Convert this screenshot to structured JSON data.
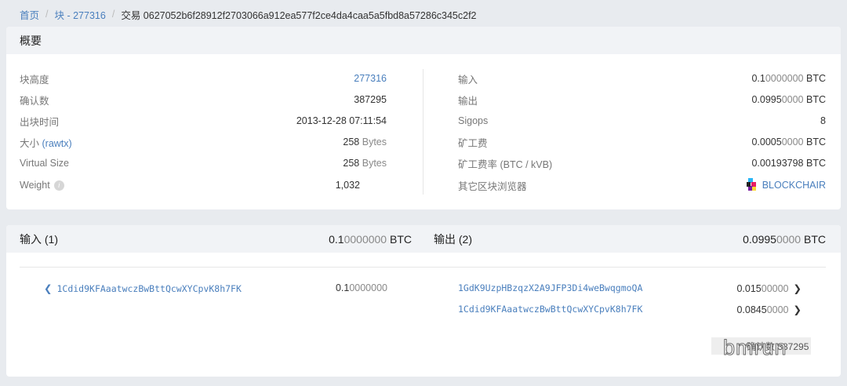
{
  "breadcrumb": {
    "home": "首页",
    "block": "块 - 277316",
    "current": "交易 0627052b6f28912f2703066a912ea577f2ce4da4caa5a5fbd8a57286c345c2f2"
  },
  "summary": {
    "title": "概要",
    "left": [
      {
        "label": "块高度",
        "value": "277316"
      },
      {
        "label": "确认数",
        "value": "387295"
      },
      {
        "label": "出块时间",
        "value": "2013-12-28 07:11:54"
      },
      {
        "label": "大小",
        "label_link": "(rawtx)",
        "value": "258",
        "unit": "Bytes"
      },
      {
        "label": "Virtual Size",
        "value": "258",
        "unit": "Bytes"
      },
      {
        "label": "Weight",
        "value": "1,032"
      }
    ],
    "right": [
      {
        "label": "输入",
        "main": "0.1",
        "zeros": "0000000",
        "unit": "BTC"
      },
      {
        "label": "输出",
        "main": "0.0995",
        "zeros": "0000",
        "unit": "BTC"
      },
      {
        "label": "Sigops",
        "value": "8"
      },
      {
        "label": "矿工费",
        "main": "0.0005",
        "zeros": "0000",
        "unit": "BTC"
      },
      {
        "label": "矿工费率 (BTC / kVB)",
        "main": "0.00193798",
        "zeros": "",
        "unit": "BTC"
      },
      {
        "label": "其它区块浏览器",
        "link": "BLOCKCHAIR"
      }
    ]
  },
  "io": {
    "inputs_title": "输入 (1)",
    "inputs_main": "0.1",
    "inputs_zeros": "0000000",
    "outputs_title": "输出 (2)",
    "outputs_main": "0.0995",
    "outputs_zeros": "0000",
    "unit": "BTC",
    "inputs": [
      {
        "address": "1Cdid9KFAaatwczBwBttQcwXYCpvK8h7FK",
        "main": "0.1",
        "zeros": "0000000"
      }
    ],
    "outputs": [
      {
        "address": "1GdK9UzpHBzqzX2A9JFP3Di4weBwqgmoQA",
        "main": "0.015",
        "zeros": "00000"
      },
      {
        "address": "1Cdid9KFAaatwczBwBttQcwXYCpvK8h7FK",
        "main": "0.0845",
        "zeros": "0000"
      }
    ]
  },
  "confirmations_badge": "确认数 387295",
  "watermark": "bmrun",
  "colors": {
    "link": "#4a7fbd",
    "bg": "#e8ebef",
    "header": "#f1f3f6"
  }
}
